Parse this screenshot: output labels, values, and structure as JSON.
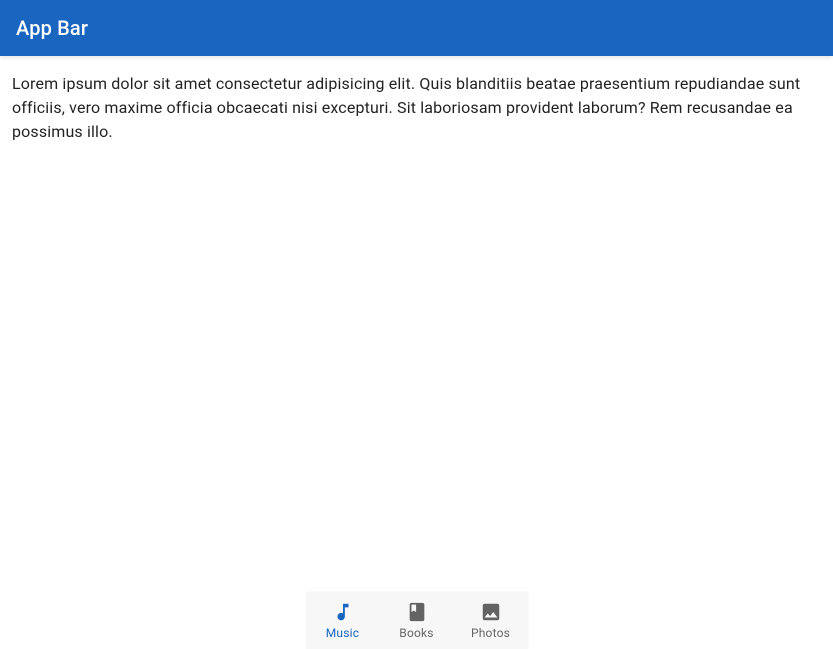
{
  "header": {
    "title": "App Bar"
  },
  "content": {
    "paragraph": "Lorem ipsum dolor sit amet consectetur adipisicing elit. Quis blanditiis beatae praesentium repudiandae sunt officiis, vero maxime officia obcaecati nisi excepturi. Sit laboriosam provident laborum? Rem recusandae ea possimus illo."
  },
  "bottomNav": {
    "items": [
      {
        "label": "Music",
        "icon": "music-note-icon",
        "active": true
      },
      {
        "label": "Books",
        "icon": "book-icon",
        "active": false
      },
      {
        "label": "Photos",
        "icon": "image-icon",
        "active": false
      }
    ]
  },
  "colors": {
    "primary": "#1a65c0",
    "inactive": "rgba(0,0,0,0.6)"
  }
}
